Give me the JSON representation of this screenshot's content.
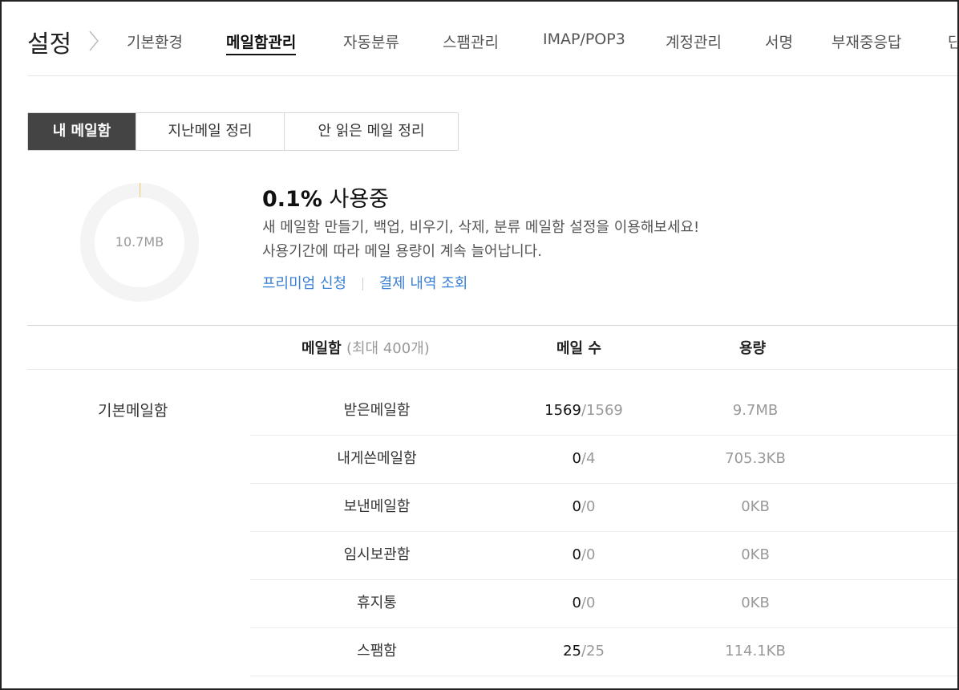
{
  "header": {
    "title": "설정",
    "tabs": [
      {
        "label": "기본환경",
        "active": false
      },
      {
        "label": "메일함관리",
        "active": true
      },
      {
        "label": "자동분류",
        "active": false
      },
      {
        "label": "스팸관리",
        "active": false
      },
      {
        "label": "IMAP/POP3",
        "active": false
      },
      {
        "label": "계정관리",
        "active": false
      },
      {
        "label": "서명",
        "active": false
      },
      {
        "label": "부재중응답",
        "active": false
      },
      {
        "label": "단",
        "active": false
      }
    ]
  },
  "segments": [
    {
      "label": "내 메일함",
      "active": true
    },
    {
      "label": "지난메일 정리",
      "active": false
    },
    {
      "label": "안 읽은 메일 정리",
      "active": false
    }
  ],
  "usage": {
    "total": "10.7MB",
    "percent": "0.1%",
    "percent_value": 0.1,
    "status": "사용중",
    "desc1": "새 메일함 만들기, 백업, 비우기, 삭제, 분류 메일함 설정을 이용해보세요!",
    "desc2": "사용기간에 따라 메일 용량이 계속 늘어납니다.",
    "link_premium": "프리미엄 신청",
    "link_payment": "결제 내역 조회"
  },
  "table": {
    "col_mailbox": "메일함",
    "col_mailbox_note": "(최대 400개)",
    "col_count": "메일 수",
    "col_size": "용량",
    "group": "기본메일함",
    "rows": [
      {
        "name": "받은메일함",
        "count": "1569",
        "total": "/1569",
        "size": "9.7MB"
      },
      {
        "name": "내게쓴메일함",
        "count": "0",
        "total": "/4",
        "size": "705.3KB"
      },
      {
        "name": "보낸메일함",
        "count": "0",
        "total": "/0",
        "size": "0KB"
      },
      {
        "name": "임시보관함",
        "count": "0",
        "total": "/0",
        "size": "0KB"
      },
      {
        "name": "휴지통",
        "count": "0",
        "total": "/0",
        "size": "0KB"
      },
      {
        "name": "스팸함",
        "count": "25",
        "total": "/25",
        "size": "114.1KB"
      }
    ]
  }
}
